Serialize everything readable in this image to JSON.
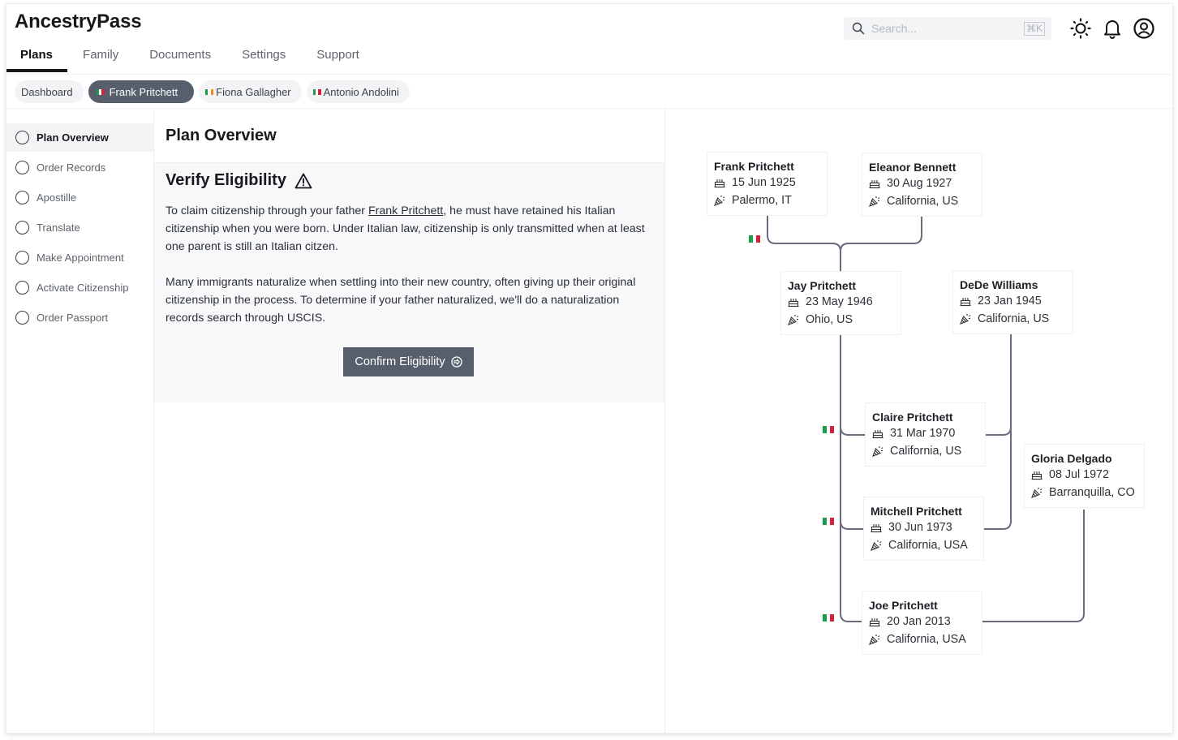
{
  "app": {
    "title": "AncestryPass"
  },
  "nav": {
    "tabs": [
      {
        "label": "Plans",
        "active": true
      },
      {
        "label": "Family",
        "active": false
      },
      {
        "label": "Documents",
        "active": false
      },
      {
        "label": "Settings",
        "active": false
      },
      {
        "label": "Support",
        "active": false
      }
    ]
  },
  "header": {
    "search_placeholder": "Search...",
    "search_shortcut": "⌘K",
    "icons": [
      "sun-icon",
      "bell-icon",
      "user-circle-icon"
    ]
  },
  "breadcrumbs": [
    {
      "label": "Dashboard",
      "flag": null,
      "active": false
    },
    {
      "label": "Frank Pritchett",
      "flag": "IT",
      "active": true
    },
    {
      "label": "Fiona Gallagher",
      "flag": "IE",
      "active": false
    },
    {
      "label": "Antonio Andolini",
      "flag": "IT",
      "active": false
    }
  ],
  "sidebar": {
    "items": [
      {
        "label": "Plan Overview",
        "active": true
      },
      {
        "label": "Order Records",
        "active": false
      },
      {
        "label": "Apostille",
        "active": false
      },
      {
        "label": "Translate",
        "active": false
      },
      {
        "label": "Make Appointment",
        "active": false
      },
      {
        "label": "Activate Citizenship",
        "active": false
      },
      {
        "label": "Order Passport",
        "active": false
      }
    ]
  },
  "main": {
    "title": "Plan Overview",
    "card": {
      "heading": "Verify Eligibility",
      "para1_pre": "To claim citizenship through your father ",
      "para1_link": "Frank Pritchett",
      "para1_post": ", he must have retained his Italian citizenship when you were born. Under Italian law, citizenship is only transmitted when at least one parent is still an Italian citzen.",
      "para2": "Many immigrants naturalize when settling into their new country, often giving up their original citizenship in the process. To determine if your father naturalized, we'll do a naturalization records search through USCIS.",
      "button_label": "Confirm Eligibility"
    }
  },
  "colors": {
    "accent": "#565f6b",
    "line": "#6b6b80",
    "italy_green": "#1e9a4b",
    "italy_red": "#d4213d",
    "ireland_orange": "#f08a1c"
  },
  "tree": {
    "people": [
      {
        "name": "Frank Pritchett",
        "born": "15 Jun 1925",
        "place": "Palermo, IT",
        "italian": true
      },
      {
        "name": "Eleanor Bennett",
        "born": "30 Aug 1927",
        "place": "California, US",
        "italian": false
      },
      {
        "name": "Jay Pritchett",
        "born": "23 May 1946",
        "place": "Ohio, US",
        "italian": false
      },
      {
        "name": "DeDe Williams",
        "born": "23 Jan 1945",
        "place": "California, US",
        "italian": false
      },
      {
        "name": "Claire Pritchett",
        "born": "31 Mar 1970",
        "place": "California, US",
        "italian": true
      },
      {
        "name": "Gloria Delgado",
        "born": "08 Jul 1972",
        "place": "Barranquilla, CO",
        "italian": false
      },
      {
        "name": "Mitchell Pritchett",
        "born": "30 Jun 1973",
        "place": "California, USA",
        "italian": true
      },
      {
        "name": "Joe Pritchett",
        "born": "20 Jan 2013",
        "place": "California, USA",
        "italian": true
      }
    ]
  }
}
